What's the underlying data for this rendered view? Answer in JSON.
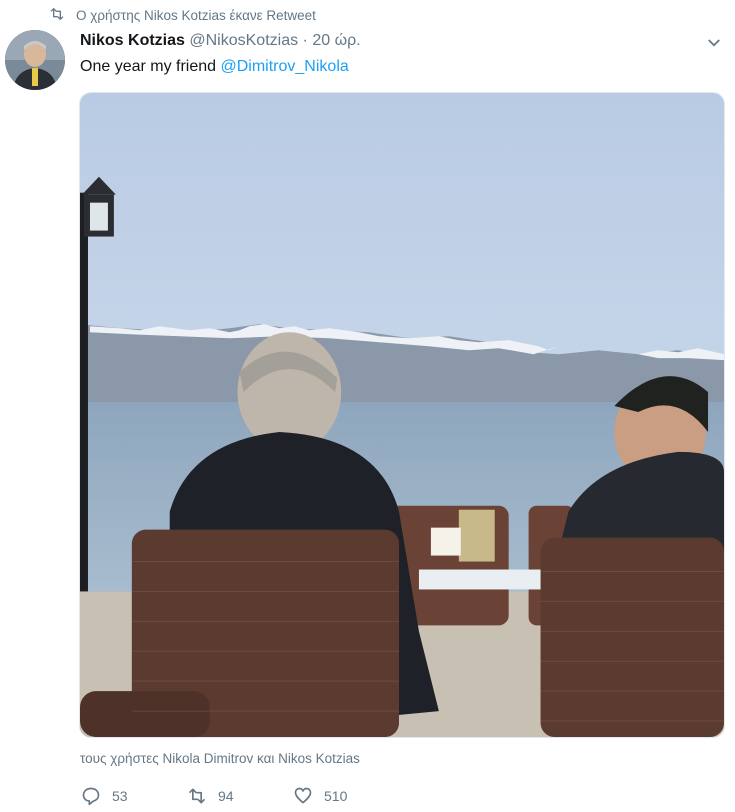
{
  "retweet_notice": {
    "icon": "retweet-icon",
    "text": "Ο χρήστης Nikos Kotzias έκανε Retweet"
  },
  "tweet": {
    "author_name": "Nikos Kotzias",
    "author_handle": "@NikosKotzias",
    "separator": "·",
    "timestamp": "20 ώρ.",
    "text_prefix": "One year my friend ",
    "mention": "@Dimitrov_Nikola",
    "tagged_users": "τους χρήστες Nikola Dimitrov και Nikos Kotzias"
  },
  "actions": {
    "reply_count": "53",
    "retweet_count": "94",
    "like_count": "510"
  },
  "colors": {
    "link": "#1da1f2",
    "secondary_text": "#657786"
  }
}
